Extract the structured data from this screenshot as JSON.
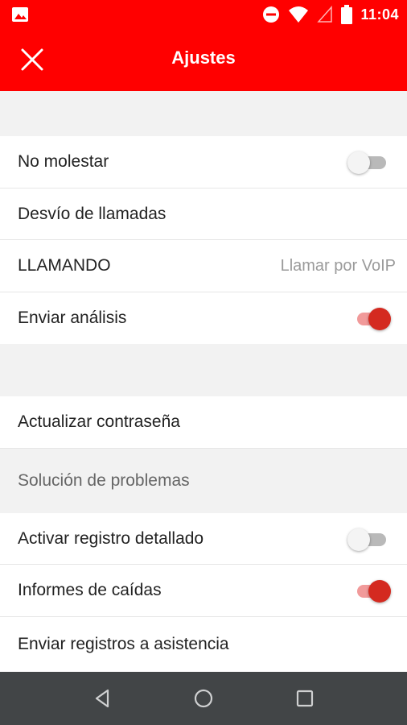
{
  "status_bar": {
    "time": "11:04",
    "icons": [
      "image-icon",
      "do-not-disturb-icon",
      "wifi-icon",
      "signal-icon",
      "battery-icon"
    ]
  },
  "app_bar": {
    "title": "Ajustes",
    "close_icon": "close-icon"
  },
  "settings": {
    "no_molestar": {
      "label": "No molestar",
      "toggle_on": false
    },
    "desvio": {
      "label": "Desvío de llamadas"
    },
    "llamando": {
      "label": "LLAMANDO",
      "value": "Llamar por VoIP"
    },
    "enviar_analisis": {
      "label": "Enviar análisis",
      "toggle_on": true
    },
    "actualizar_contrasena": {
      "label": "Actualizar contraseña"
    },
    "troubleshooting_header": "Solución de problemas",
    "registro_detallado": {
      "label": "Activar registro detallado",
      "toggle_on": false
    },
    "informes_caidas": {
      "label": "Informes de caídas",
      "toggle_on": true
    },
    "enviar_registros": {
      "label": "Enviar registros a asistencia"
    }
  },
  "nav_bar": {
    "buttons": [
      "back-icon",
      "home-icon",
      "recents-icon"
    ]
  },
  "colors": {
    "accent": "#ff0000",
    "toggle_on": "#d42a20",
    "nav_bar": "#424547"
  }
}
